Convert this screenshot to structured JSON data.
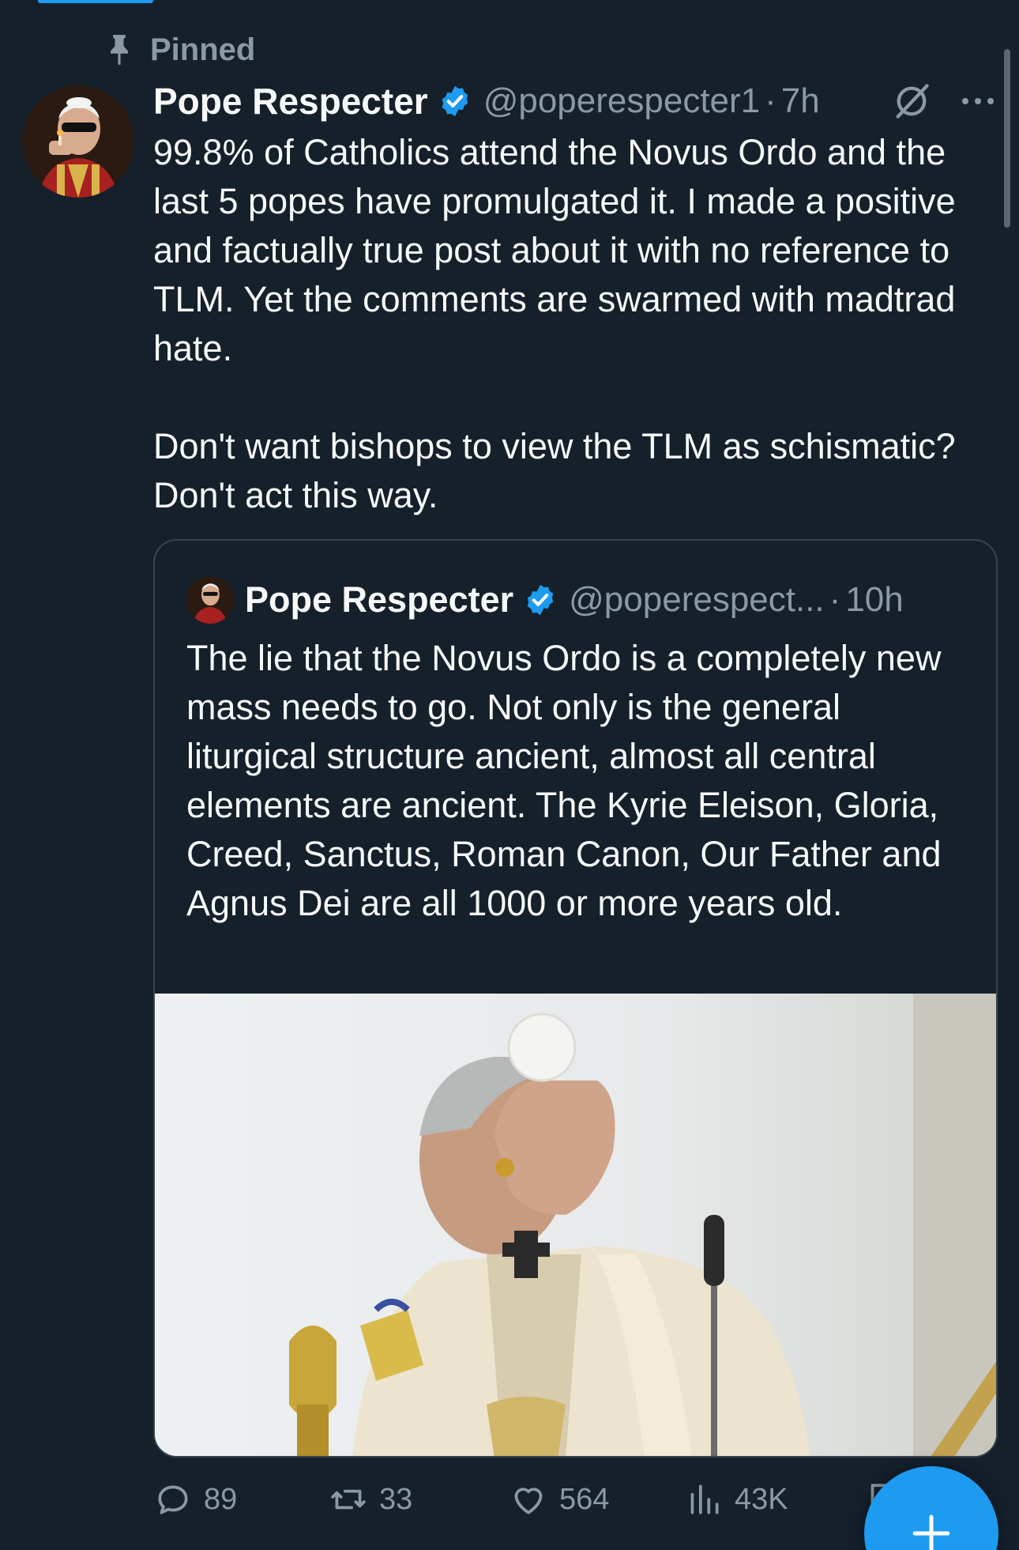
{
  "pinned_label": "Pinned",
  "post": {
    "author": "Pope Respecter",
    "handle": "@poperespecter1",
    "separator": "·",
    "time": "7h",
    "paragraphs": [
      "99.8% of Catholics attend the Novus Ordo and the last 5 popes have promulgated it. I made a positive and factually true post about it with no reference to TLM. Yet the comments are swarmed with madtrad hate.",
      "Don't want bishops to view the TLM as schismatic? Don't act this way."
    ]
  },
  "quote": {
    "author": "Pope Respecter",
    "handle": "@poperespect...",
    "separator": "·",
    "time": "10h",
    "text": "The lie that the Novus Ordo is a completely new mass needs to go. Not only is the general liturgical structure ancient, almost all central elements are ancient. The Kyrie Eleison, Gloria, Creed, Sanctus, Roman Canon, Our Father and Agnus Dei are all 1000 or more years old."
  },
  "actions": {
    "replies": "89",
    "reposts": "33",
    "likes": "564",
    "views": "43K"
  },
  "colors": {
    "background": "#15202b",
    "accent": "#1d9bf0",
    "muted": "#8b98a5",
    "text": "#f7f9f9",
    "border": "#38444d"
  },
  "icons": {
    "pin": "pin-icon",
    "verified": "verified-badge-icon",
    "grok": "grok-icon",
    "more": "more-icon",
    "reply": "reply-icon",
    "repost": "repost-icon",
    "like": "heart-icon",
    "views": "views-icon",
    "bookmark": "bookmark-icon",
    "share": "share-icon",
    "compose": "plus-icon"
  }
}
